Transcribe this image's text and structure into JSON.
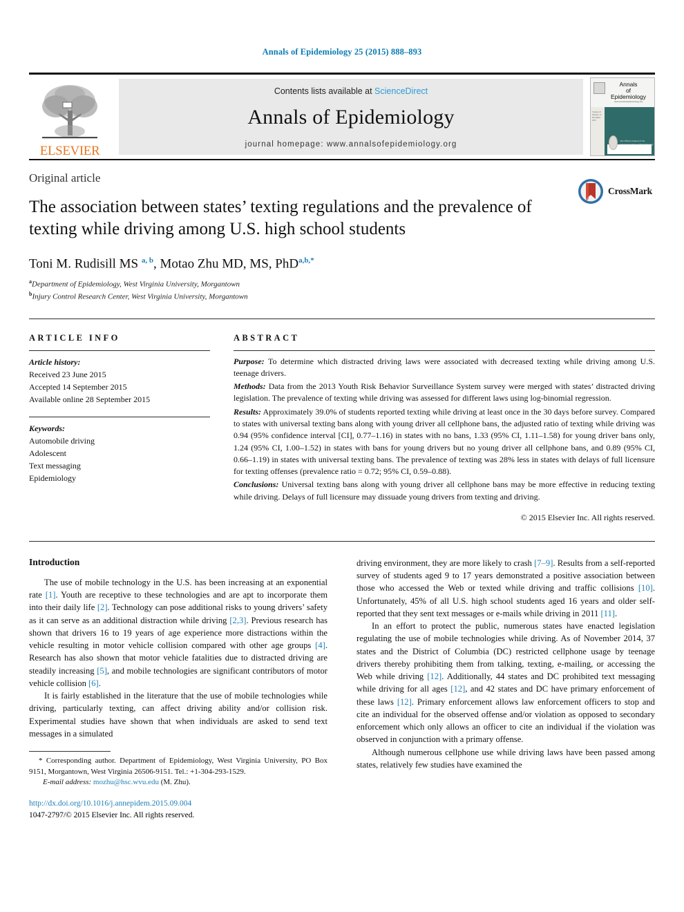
{
  "running_head": "Annals of Epidemiology 25 (2015) 888–893",
  "masthead": {
    "publisher_wordmark": "ELSEVIER",
    "contents_prefix": "Contents lists available at ",
    "contents_link": "ScienceDirect",
    "journal_name": "Annals of Epidemiology",
    "homepage": "journal homepage: www.annalsofepidemiology.org",
    "cover": {
      "title_line1": "Annals",
      "title_line2": "of",
      "title_line3": "Epidemiology",
      "subtitle": "www.annalsofepidemiology.org",
      "strip_text": "Volume 25 Number 12 December 2015",
      "seal_text": "The Official Journal of the American College of Epidemiology"
    }
  },
  "article": {
    "type": "Original article",
    "title": "The association between states’ texting regulations and the prevalence of texting while driving among U.S. high school students",
    "crossmark_label": "CrossMark",
    "authors_html": "Toni M. Rudisill MS <sup>a, b</sup>, Motao Zhu MD, MS, PhD<sup>a,b,</sup><sup>*</sup>",
    "affiliations": [
      {
        "marker": "a",
        "text": "Department of Epidemiology, West Virginia University, Morgantown"
      },
      {
        "marker": "b",
        "text": "Injury Control Research Center, West Virginia University, Morgantown"
      }
    ]
  },
  "article_info": {
    "heading": "ARTICLE INFO",
    "history_label": "Article history:",
    "history": [
      "Received 23 June 2015",
      "Accepted 14 September 2015",
      "Available online 28 September 2015"
    ],
    "keywords_label": "Keywords:",
    "keywords": [
      "Automobile driving",
      "Adolescent",
      "Text messaging",
      "Epidemiology"
    ]
  },
  "abstract": {
    "heading": "ABSTRACT",
    "purpose_label": "Purpose:",
    "purpose_text": " To determine which distracted driving laws were associated with decreased texting while driving among U.S. teenage drivers.",
    "methods_label": "Methods:",
    "methods_text": " Data from the 2013 Youth Risk Behavior Surveillance System survey were merged with states’ distracted driving legislation. The prevalence of texting while driving was assessed for different laws using log-binomial regression.",
    "results_label": "Results:",
    "results_text": " Approximately 39.0% of students reported texting while driving at least once in the 30 days before survey. Compared to states with universal texting bans along with young driver all cellphone bans, the adjusted ratio of texting while driving was 0.94 (95% confidence interval [CI], 0.77–1.16) in states with no bans, 1.33 (95% CI, 1.11–1.58) for young driver bans only, 1.24 (95% CI, 1.00–1.52) in states with bans for young drivers but no young driver all cellphone bans, and 0.89 (95% CI, 0.66–1.19) in states with universal texting bans. The prevalence of texting was 28% less in states with delays of full licensure for texting offenses (prevalence ratio = 0.72; 95% CI, 0.59–0.88).",
    "conclusions_label": "Conclusions:",
    "conclusions_text": " Universal texting bans along with young driver all cellphone bans may be more effective in reducing texting while driving. Delays of full licensure may dissuade young drivers from texting and driving.",
    "copyright": "© 2015 Elsevier Inc. All rights reserved."
  },
  "introduction": {
    "heading": "Introduction",
    "p1_html": "The use of mobile technology in the U.S. has been increasing at an exponential rate <span class=\"ref\">[1]</span>. Youth are receptive to these technologies and are apt to incorporate them into their daily life <span class=\"ref\">[2]</span>. Technology can pose additional risks to young drivers’ safety as it can serve as an additional distraction while driving <span class=\"ref\">[2,3]</span>. Previous research has shown that drivers 16 to 19 years of age experience more distractions within the vehicle resulting in motor vehicle collision compared with other age groups <span class=\"ref\">[4]</span>. Research has also shown that motor vehicle fatalities due to distracted driving are steadily increasing <span class=\"ref\">[5]</span>, and mobile technologies are significant contributors of motor vehicle collision <span class=\"ref\">[6]</span>.",
    "p2_html": "It is fairly established in the literature that the use of mobile technologies while driving, particularly texting, can affect driving ability and/or collision risk. Experimental studies have shown that when individuals are asked to send text messages in a simulated",
    "p3_html": "driving environment, they are more likely to crash <span class=\"ref\">[7–9]</span>. Results from a self-reported survey of students aged 9 to 17 years demonstrated a positive association between those who accessed the Web or texted while driving and traffic collisions <span class=\"ref\">[10]</span>. Unfortunately, 45% of all U.S. high school students aged 16 years and older self-reported that they sent text messages or e-mails while driving in 2011 <span class=\"ref\">[11]</span>.",
    "p4_html": "In an effort to protect the public, numerous states have enacted legislation regulating the use of mobile technologies while driving. As of November 2014, 37 states and the District of Columbia (DC) restricted cellphone usage by teenage drivers thereby prohibiting them from talking, texting, e-mailing, or accessing the Web while driving <span class=\"ref\">[12]</span>. Additionally, 44 states and DC prohibited text messaging while driving for all ages <span class=\"ref\">[12]</span>, and 42 states and DC have primary enforcement of these laws <span class=\"ref\">[12]</span>. Primary enforcement allows law enforcement officers to stop and cite an individual for the observed offense and/or violation as opposed to secondary enforcement which only allows an officer to cite an individual if the violation was observed in conjunction with a primary offense.",
    "p5_html": "Although numerous cellphone use while driving laws have been passed among states, relatively few studies have examined the"
  },
  "footnote": {
    "corresponding_html": "* Corresponding author. Department of Epidemiology, West Virginia University, PO Box 9151, Morgantown, West Virginia 26506-9151. Tel.: +1-304-293-1529.",
    "email_label": "E-mail address:",
    "email": "mozhu@hsc.wvu.edu",
    "email_suffix": " (M. Zhu)."
  },
  "imprint": {
    "doi": "http://dx.doi.org/10.1016/j.annepidem.2015.09.004",
    "issn_line": "1047-2797/© 2015 Elsevier Inc. All rights reserved."
  },
  "colors": {
    "link_blue": "#1f7fb8",
    "header_blue": "#0b7bb5",
    "elsevier_orange": "#e87722",
    "banner_gray": "#e9e9e9",
    "cover_teal": "#2f6b68"
  }
}
